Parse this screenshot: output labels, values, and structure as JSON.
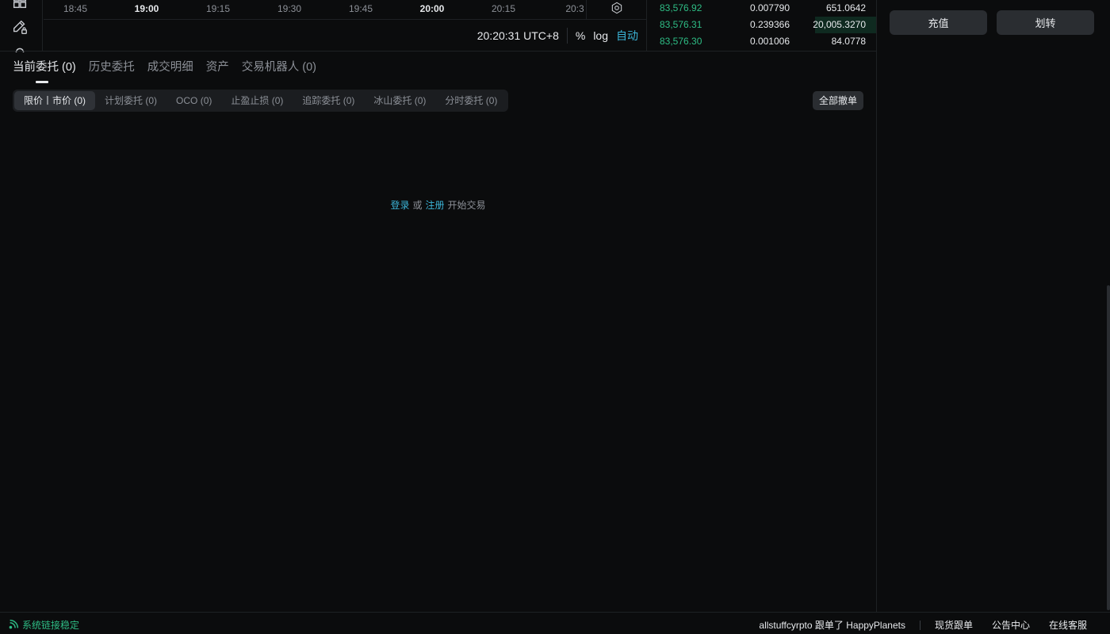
{
  "toolbar": {
    "icons": [
      "grid-icon",
      "pencil-lock-icon",
      "magnet-icon"
    ]
  },
  "chart": {
    "time_ticks": [
      {
        "label": "18:45",
        "bold": false
      },
      {
        "label": "19:00",
        "bold": true
      },
      {
        "label": "19:15",
        "bold": false
      },
      {
        "label": "19:30",
        "bold": false
      },
      {
        "label": "19:45",
        "bold": false
      },
      {
        "label": "20:00",
        "bold": true
      },
      {
        "label": "20:15",
        "bold": false
      },
      {
        "label": "20:3",
        "bold": false
      }
    ],
    "clock": "20:20:31 UTC+8",
    "opt_percent": "%",
    "opt_log": "log",
    "opt_auto": "自动"
  },
  "orderbook": {
    "rows": [
      {
        "price": "83,576.92",
        "amount": "0.007790",
        "total": "651.0642",
        "depth": 0.0
      },
      {
        "price": "83,576.31",
        "amount": "0.239366",
        "total": "20,005.3270",
        "depth": 0.27
      },
      {
        "price": "83,576.30",
        "amount": "0.001006",
        "total": "84.0778",
        "depth": 0.0
      }
    ]
  },
  "right_panel": {
    "deposit_label": "充值",
    "transfer_label": "划转"
  },
  "orders": {
    "tabs": [
      {
        "label": "当前委托 (0)",
        "active": true
      },
      {
        "label": "历史委托",
        "active": false
      },
      {
        "label": "成交明细",
        "active": false
      },
      {
        "label": "资产",
        "active": false
      },
      {
        "label": "交易机器人 (0)",
        "active": false
      }
    ],
    "subtabs": [
      {
        "label": "限价丨市价 (0)",
        "active": true
      },
      {
        "label": "计划委托 (0)",
        "active": false
      },
      {
        "label": "OCO (0)",
        "active": false
      },
      {
        "label": "止盈止损 (0)",
        "active": false
      },
      {
        "label": "追踪委托 (0)",
        "active": false
      },
      {
        "label": "冰山委托 (0)",
        "active": false
      },
      {
        "label": "分时委托 (0)",
        "active": false
      }
    ],
    "cancel_all_label": "全部撤单",
    "empty": {
      "login": "登录",
      "or": "或",
      "register": "注册",
      "suffix": "开始交易"
    }
  },
  "statusbar": {
    "connection": "系统链接稳定",
    "follow_text": "allstuffcyrpto 跟单了 HappyPlanets",
    "links": [
      "现货跟单",
      "公告中心",
      "在线客服"
    ]
  },
  "colors": {
    "accent": "#3bb3d6",
    "buy_green": "#2ebd85",
    "background": "#0b0c0d"
  }
}
